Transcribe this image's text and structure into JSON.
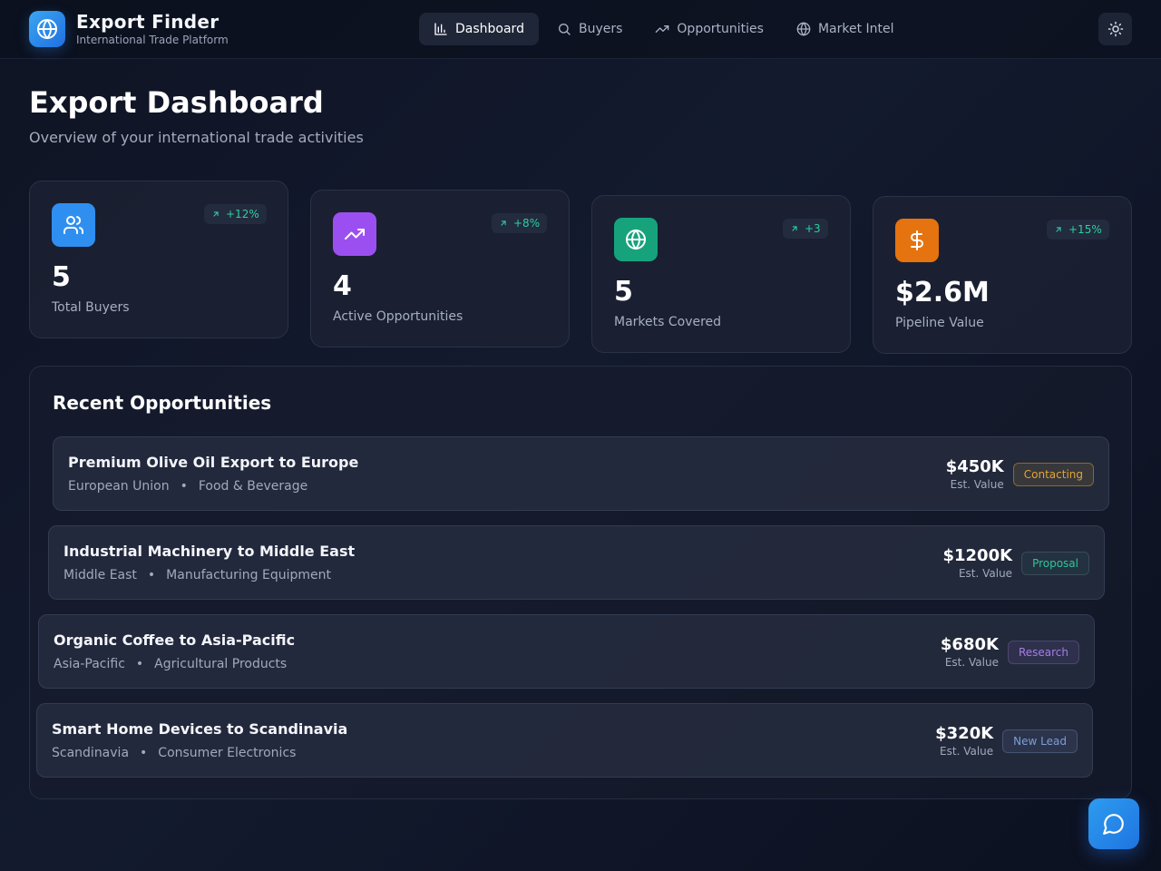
{
  "app": {
    "title": "Export Finder",
    "subtitle": "International Trade Platform",
    "logo_icon": "globe-icon"
  },
  "nav": [
    {
      "label": "Dashboard",
      "icon": "bar-chart-icon",
      "active": true
    },
    {
      "label": "Buyers",
      "icon": "search-icon",
      "active": false
    },
    {
      "label": "Opportunities",
      "icon": "trending-up-icon",
      "active": false
    },
    {
      "label": "Market Intel",
      "icon": "globe-icon",
      "active": false
    }
  ],
  "theme_toggle_icon": "sun-icon",
  "page": {
    "title": "Export Dashboard",
    "subtitle": "Overview of your international trade activities"
  },
  "stats": [
    {
      "value": "5",
      "label": "Total Buyers",
      "change": "+12%",
      "icon": "users-icon",
      "color": "#2f8ff0"
    },
    {
      "value": "4",
      "label": "Active Opportunities",
      "change": "+8%",
      "icon": "trending-up-icon",
      "color": "#9b4ff0"
    },
    {
      "value": "5",
      "label": "Markets Covered",
      "change": "+3",
      "icon": "globe-icon",
      "color": "#16a37c"
    },
    {
      "value": "$2.6M",
      "label": "Pipeline Value",
      "change": "+15%",
      "icon": "dollar-icon",
      "color": "#e5730f"
    }
  ],
  "opportunities": {
    "title": "Recent Opportunities",
    "value_label": "Est. Value",
    "items": [
      {
        "name": "Premium Olive Oil Export to Europe",
        "region": "European Union",
        "category": "Food & Beverage",
        "value": "$450K",
        "status": "Contacting",
        "status_color": "#e0a43a"
      },
      {
        "name": "Industrial Machinery to Middle East",
        "region": "Middle East",
        "category": "Manufacturing Equipment",
        "value": "$1200K",
        "status": "Proposal",
        "status_color": "#2ec49a"
      },
      {
        "name": "Organic Coffee to Asia-Pacific",
        "region": "Asia-Pacific",
        "category": "Agricultural Products",
        "value": "$680K",
        "status": "Research",
        "status_color": "#a57de6"
      },
      {
        "name": "Smart Home Devices to Scandinavia",
        "region": "Scandinavia",
        "category": "Consumer Electronics",
        "value": "$320K",
        "status": "New Lead",
        "status_color": "#7f9dd6"
      }
    ]
  },
  "chat_icon": "chat-bubble-icon"
}
